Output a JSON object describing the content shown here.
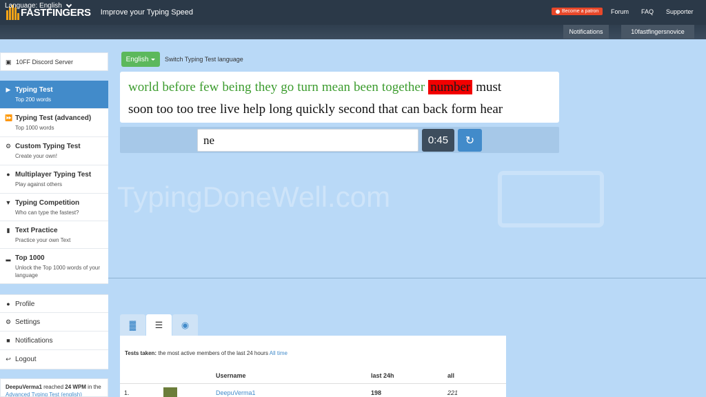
{
  "header": {
    "logo_text": "FASTFINGERS",
    "tagline": "Improve your Typing Speed",
    "patron_label": "Become a patron",
    "links": [
      "Forum",
      "FAQ",
      "Supporter"
    ]
  },
  "subbar": {
    "language_label": "Language: English",
    "notifications_label": "Notifications",
    "username": "10fastfingersnovice"
  },
  "sidebar": {
    "discord": "10FF Discord Server",
    "items": [
      {
        "title": "Typing Test",
        "sub": "Top 200 words",
        "icon": "play-icon"
      },
      {
        "title": "Typing Test (advanced)",
        "sub": "Top 1000 words",
        "icon": "fast-forward-icon"
      },
      {
        "title": "Custom Typing Test",
        "sub": "Create your own!",
        "icon": "cogs-icon"
      },
      {
        "title": "Multiplayer Typing Test",
        "sub": "Play against others",
        "icon": "users-icon"
      },
      {
        "title": "Typing Competition",
        "sub": "Who can type the fastest?",
        "icon": "trophy-icon"
      },
      {
        "title": "Text Practice",
        "sub": "Practice your own Text",
        "icon": "book-icon"
      },
      {
        "title": "Top 1000",
        "sub": "Unlock the Top 1000 words of your language",
        "icon": "signal-icon"
      }
    ],
    "account": [
      {
        "title": "Profile",
        "icon": "user-icon"
      },
      {
        "title": "Settings",
        "icon": "gear-icon"
      },
      {
        "title": "Notifications",
        "icon": "comment-icon"
      },
      {
        "title": "Logout",
        "icon": "logout-icon"
      }
    ],
    "feed": {
      "user": "DeepuVerma1",
      "text_mid": " reached ",
      "wpm": "24 WPM",
      "text_end": " in the ",
      "link": "Advanced Typing Test (english)"
    }
  },
  "test": {
    "language_button": "English",
    "switch_label": "Switch Typing Test language",
    "line1_correct": [
      "world",
      "before",
      "few",
      "being",
      "they",
      "go",
      "turn",
      "mean",
      "been",
      "together"
    ],
    "current_word": "number",
    "line1_rest": [
      "must"
    ],
    "line2": [
      "soon",
      "too",
      "too",
      "tree",
      "live",
      "help",
      "long",
      "quickly",
      "second",
      "that",
      "can",
      "back",
      "form",
      "hear"
    ],
    "input_value": "ne",
    "timer": "0:45"
  },
  "watermark": "TypingDoneWell.com",
  "stats": {
    "tests_taken_label": "Tests taken:",
    "tests_taken_desc": " the most active members of the last 24 hours ",
    "all_time_link": "All time",
    "columns": {
      "username": "Username",
      "last24": "last 24h",
      "all": "all"
    },
    "rows": [
      {
        "rank": "1.",
        "username": "DeepuVerma1",
        "last24": "198",
        "all": "221"
      }
    ]
  }
}
